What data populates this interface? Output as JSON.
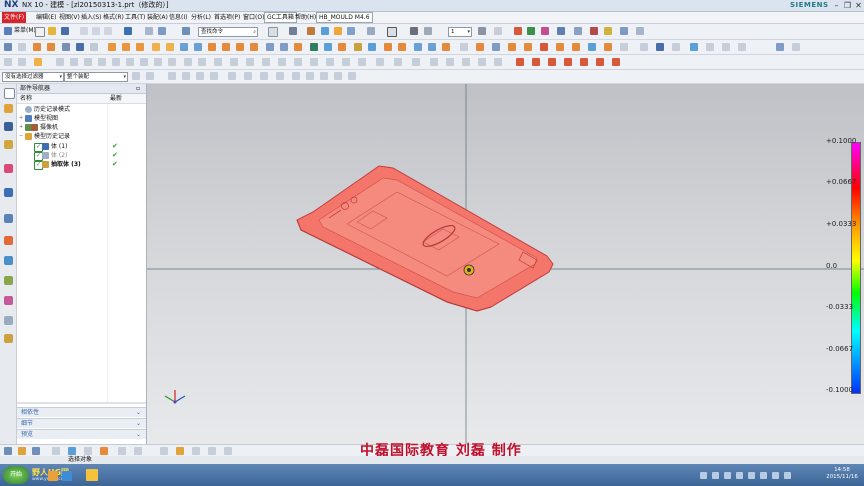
{
  "window": {
    "app_logo": "NX",
    "title": "NX 10 - 建模 - [zl20150313-1.prt（修改的）]",
    "brand": "SIEMENS",
    "buttons": [
      "minimize-icon",
      "restore-icon",
      "close-icon"
    ]
  },
  "menubar": {
    "start": "文件(F)",
    "items": [
      "编辑(E)",
      "视图(V)",
      "插入(S)",
      "格式(R)",
      "工具(T)",
      "装配(A)",
      "信息(I)",
      "分析(L)",
      "首选项(P)",
      "窗口(O)",
      "GC工具箱",
      "帮助(H)",
      "HB_MOULD M4.6"
    ]
  },
  "toolbar": {
    "menu_label": "菜单(M)",
    "search_placeholder": "查找命令",
    "layer_value": "1",
    "filter_value": "没有选择过滤器",
    "assembly_scope": "整个装配"
  },
  "navigator": {
    "title": "部件导航器",
    "columns": {
      "name": "名称",
      "latest": "最新"
    },
    "items": [
      {
        "label": "历史记录模式",
        "latest": ""
      },
      {
        "label": "模型视图",
        "latest": ""
      },
      {
        "label": "摄像机",
        "latest": ""
      },
      {
        "label": "模型历史记录",
        "latest": ""
      },
      {
        "label": "体 (1)",
        "latest": "✔"
      },
      {
        "label": "体 (2)",
        "latest": "✔"
      },
      {
        "label": "抽取体 (3)",
        "latest": "✔"
      }
    ],
    "panels": [
      "相依性",
      "细节",
      "预览"
    ]
  },
  "graphics": {
    "legend_ticks": [
      "+0.1000",
      "+0.0667",
      "+0.0333",
      "0.0",
      "-0.0333",
      "-0.0667",
      "-0.1000"
    ],
    "model_color": "#f4756a"
  },
  "caption": "中磊国际教育 刘磊 制作",
  "statusbar": {
    "message": "选择对象"
  },
  "taskbar": {
    "start_label": "开始",
    "watermark": "野人UG网",
    "watermark_url": "www.yeren.com",
    "time": "14:58",
    "date": "2015/11/16"
  }
}
